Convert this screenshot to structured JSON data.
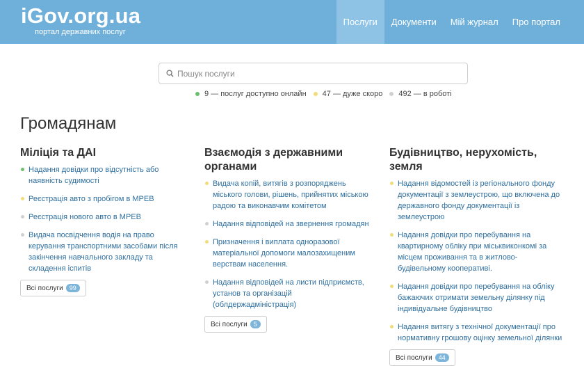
{
  "header": {
    "logo_title": "iGov.org.ua",
    "logo_subtitle": "портал державних послуг",
    "nav": [
      {
        "label": "Послуги",
        "active": true
      },
      {
        "label": "Документи",
        "active": false
      },
      {
        "label": "Мій журнал",
        "active": false
      },
      {
        "label": "Про портал",
        "active": false
      }
    ]
  },
  "search": {
    "placeholder": "Пошук послуги",
    "icon": "search-icon"
  },
  "stats": [
    {
      "text": "9 — послуг доступно онлайн",
      "color": "#6cbf6c"
    },
    {
      "text": "47 — дуже скоро",
      "color": "#f0dc7a"
    },
    {
      "text": "492 — в роботі",
      "color": "#d0d0d0"
    }
  ],
  "section_title": "Громадянам",
  "columns": [
    {
      "title": "Міліція та ДАІ",
      "items": [
        {
          "text": "Надання довідки про відсутність або наявність судимості",
          "status": "green"
        },
        {
          "text": "Реєстрація авто з пробігом в МРЕВ",
          "status": "yellow"
        },
        {
          "text": "Реєстрація нового авто в МРЕВ",
          "status": "gray"
        },
        {
          "text": "Видача посвідчення водія на право керування транспортними засобами після закінчення навчального закладу та складення іспитів",
          "status": "gray"
        }
      ],
      "all_label": "Всі послуги",
      "count": "99"
    },
    {
      "title": "Взаємодія з державними органами",
      "items": [
        {
          "text": "Видача копій, витягів з розпоряджень міського голови, рішень, прийнятих міською радою та виконавчим комітетом",
          "status": "yellow"
        },
        {
          "text": "Надання відповідей на звернення громадян",
          "status": "gray"
        },
        {
          "text": "Призначення і виплата одноразової матеріальної допомоги малозахищеним верствам населення.",
          "status": "yellow"
        },
        {
          "text": "Надання відповідей на листи підприємств, установ та організацій (облдержадміністрація)",
          "status": "gray"
        }
      ],
      "all_label": "Всі послуги",
      "count": "5"
    },
    {
      "title": "Будівництво, нерухомість, земля",
      "items": [
        {
          "text": "Надання відомостей із регіонального фонду документації з землеустрою, що включена до державного фонду документації із землеустрою",
          "status": "yellow"
        },
        {
          "text": "Надання довідки про перебування на квартирному обліку при міськвиконкомі за місцем проживання та в житлово-будівельному кооперативі.",
          "status": "yellow"
        },
        {
          "text": "Надання довідки про перебування на обліку бажаючих отримати земельну ділянку під індивідуальне будівництво",
          "status": "yellow"
        },
        {
          "text": "Надання витягу з технічної документації про нормативну грошову оцінку земельної ділянки",
          "status": "yellow"
        }
      ],
      "all_label": "Всі послуги",
      "count": "44"
    }
  ]
}
